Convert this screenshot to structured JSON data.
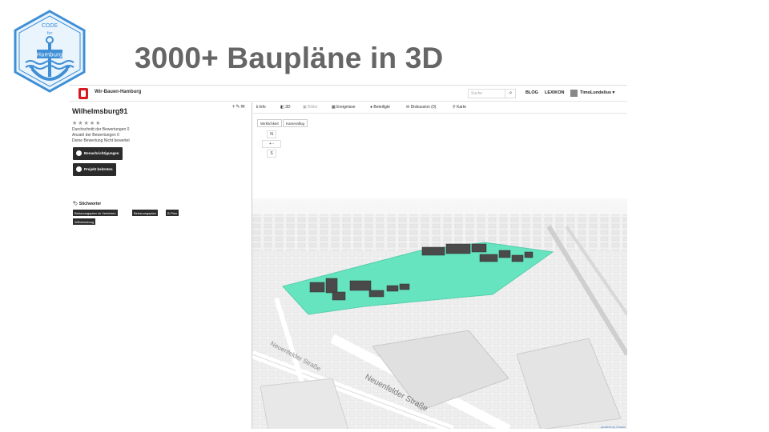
{
  "slide": {
    "title": "3000+ Baupläne in 3D",
    "logo_text_top": "CODE",
    "logo_text_mid": "for",
    "logo_text_city": "Hamburg"
  },
  "topbar": {
    "site_name": "Wir-Bauen-Hamburg",
    "search_placeholder": "Suche",
    "links": [
      "BLOG",
      "LEXIKON"
    ],
    "user": "TimoLundelius ▾"
  },
  "sidebar": {
    "project_title": "Wilhelmsburg91",
    "tools": "+✎✉",
    "stars": "★★★★★",
    "meta_lines": [
      "Durchschnitt der Bewertungen 0",
      "Anzahl der Bewertungen 0",
      "Deine Bewertung Nicht bewertet"
    ],
    "notify_button": "Benachrichtigungen",
    "leave_button": "Projekt beitreten",
    "tags_heading": "Stichworter",
    "tags": [
      "Bebauungsplan im Verfahren",
      "Bebauungsplan",
      "B-Plan",
      "Wilhelmsburg"
    ]
  },
  "tabs": [
    {
      "label": "Info",
      "icon": "info-icon"
    },
    {
      "label": "3D",
      "icon": "cube-icon"
    },
    {
      "label": "Bilder",
      "icon": "image-icon",
      "dim": true
    },
    {
      "label": "Ereignisse",
      "icon": "calendar-icon"
    },
    {
      "label": "Beteiligte",
      "icon": "person-icon"
    },
    {
      "label": "Diskussion (0)",
      "icon": "comment-icon"
    },
    {
      "label": "Karte",
      "icon": "pin-icon"
    }
  ],
  "map": {
    "btn_a": "Wirklichkeit",
    "btn_b": "Kameraflug",
    "compass_n": "N",
    "compass_s": "S",
    "zoom": "+ -",
    "street_1": "Neuenfelder Straße",
    "street_2": "Neuenfelder Straße",
    "credit": "powered by Cesium"
  },
  "colors": {
    "title": "#666666",
    "highlight": "#4fe3b8",
    "dark_button": "#2b2b2b",
    "logo_blue": "#3f8fd6"
  }
}
